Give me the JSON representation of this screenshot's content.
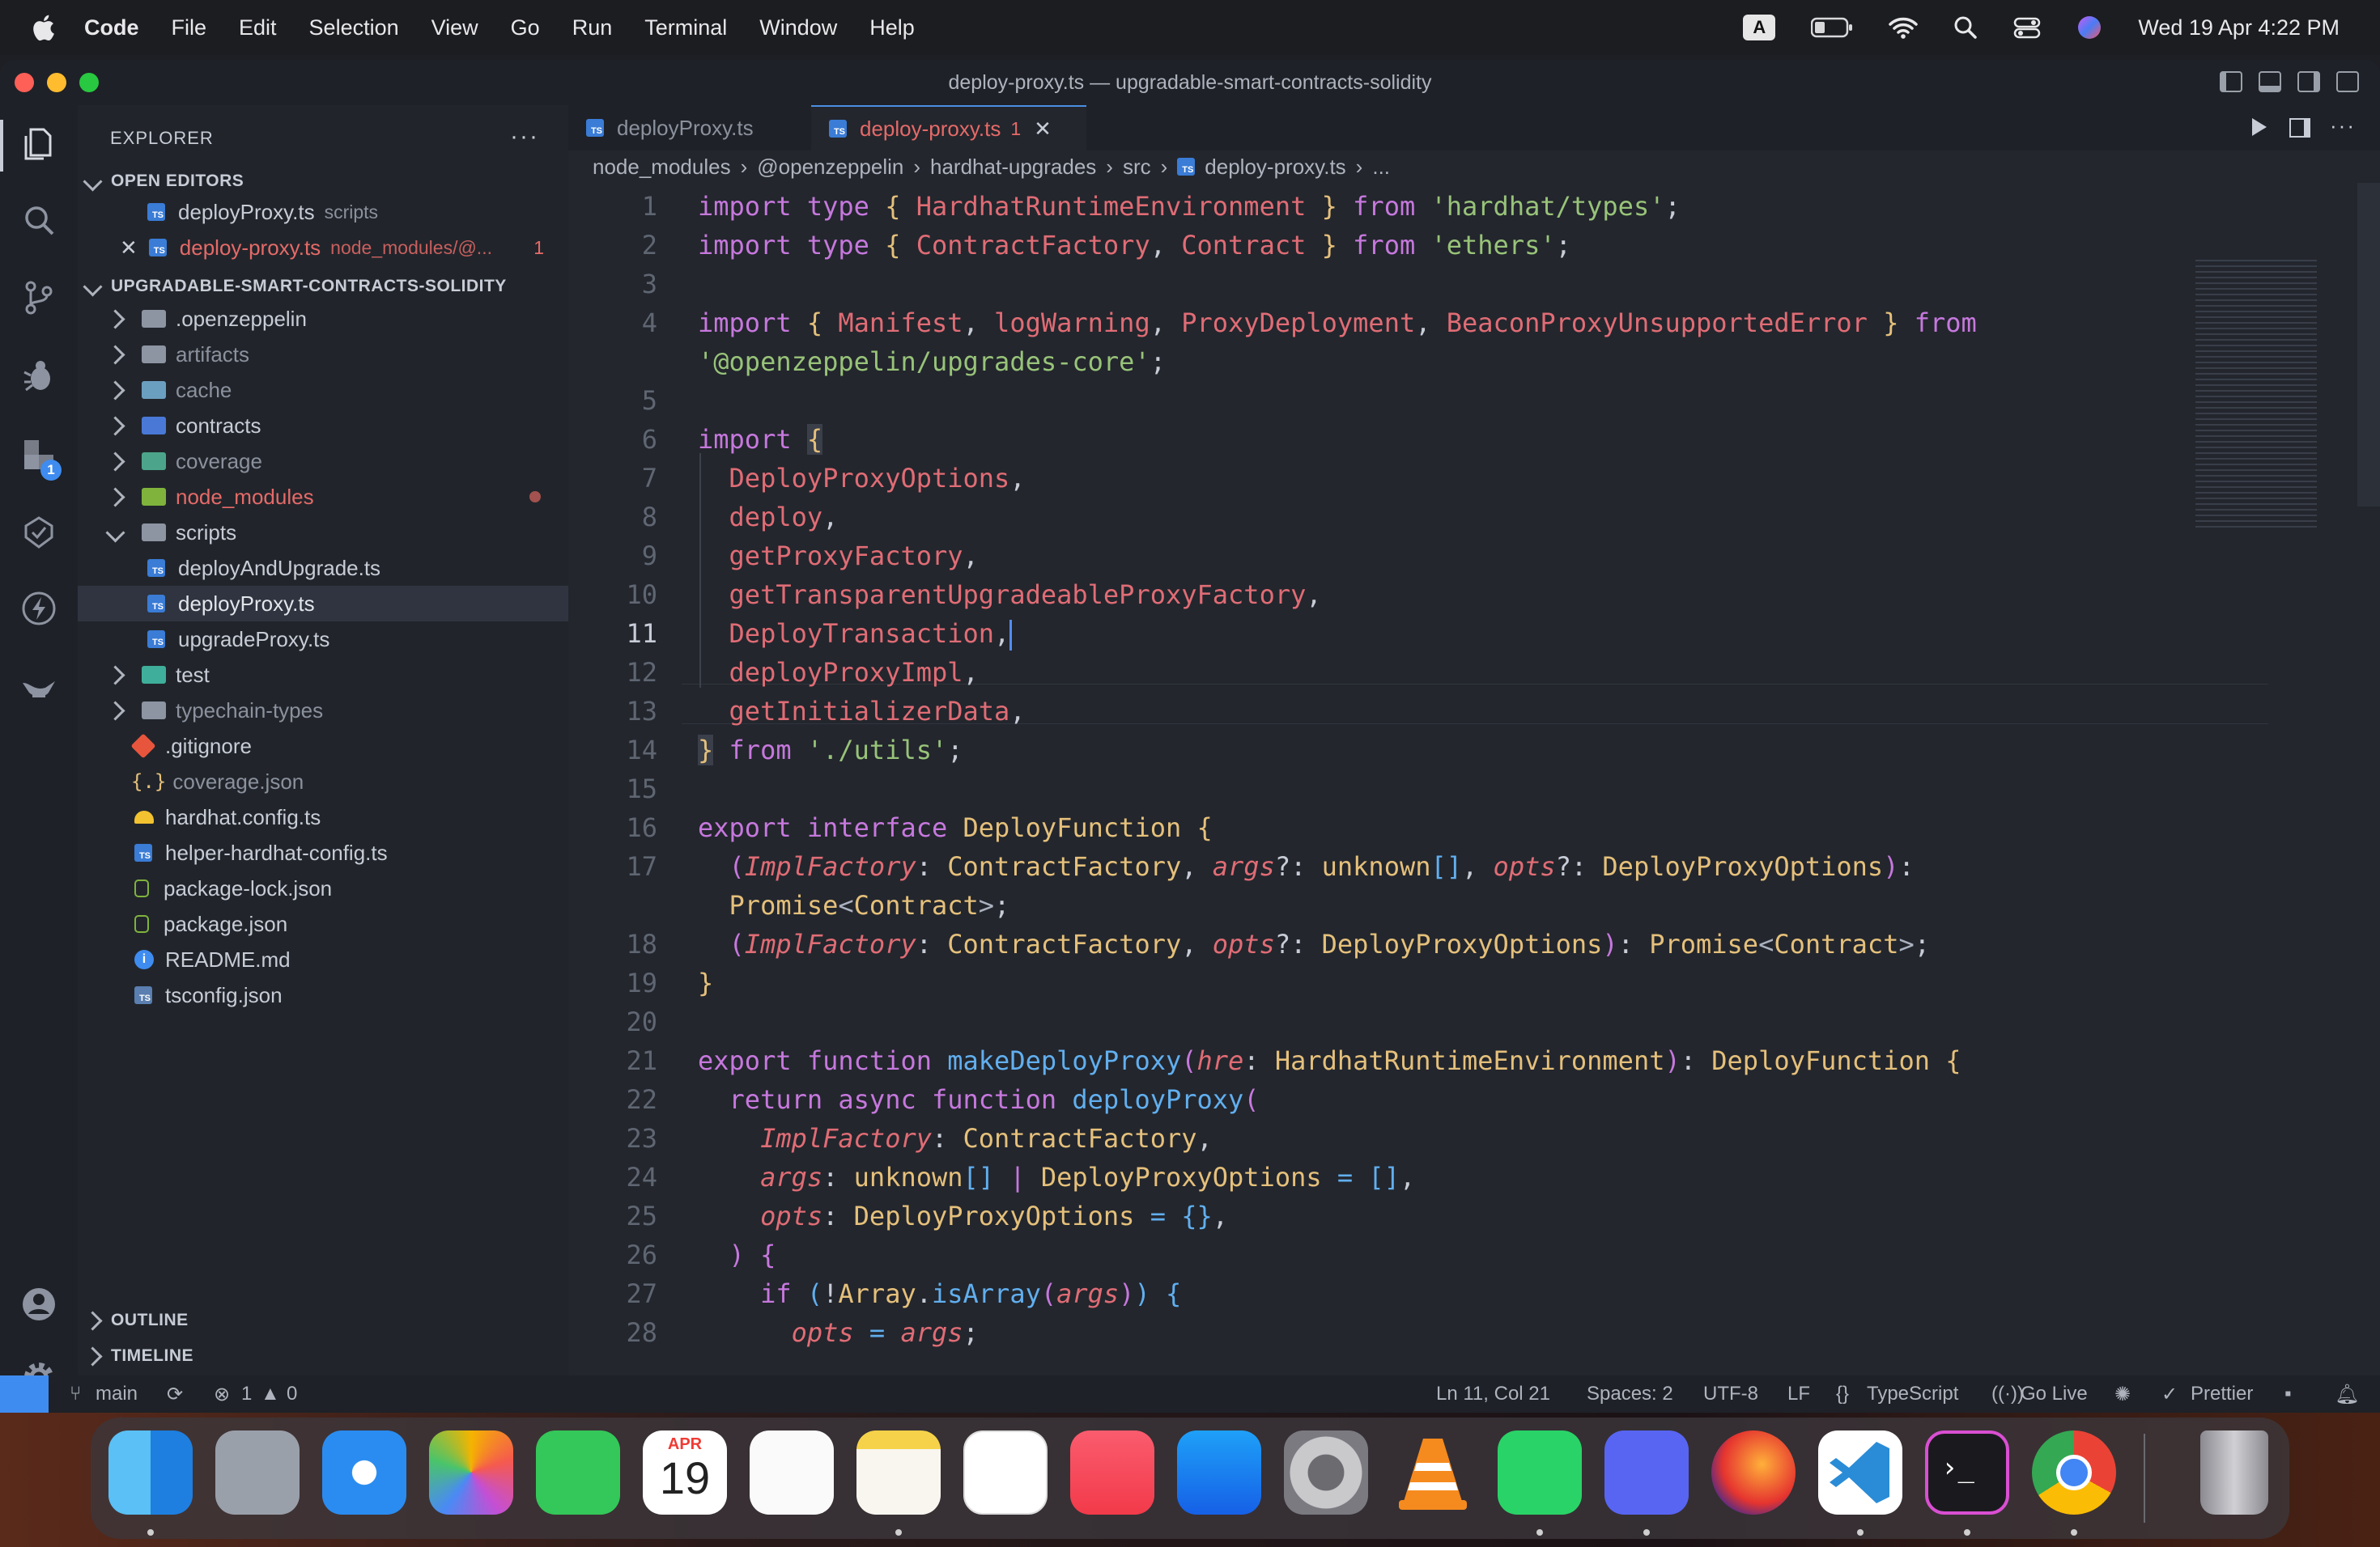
{
  "menubar": {
    "items": [
      "Code",
      "File",
      "Edit",
      "Selection",
      "View",
      "Go",
      "Run",
      "Terminal",
      "Window",
      "Help"
    ],
    "input_indicator": "A",
    "datetime": "Wed 19 Apr  4:22 PM"
  },
  "window": {
    "title": "deploy-proxy.ts — upgradable-smart-contracts-solidity"
  },
  "activity": {
    "extensions_badge": "1"
  },
  "sidebar": {
    "title": "EXPLORER",
    "more": "···",
    "open_editors_label": "OPEN EDITORS",
    "open_editors": [
      {
        "name": "deployProxy.ts",
        "desc": "scripts"
      },
      {
        "name": "deploy-proxy.ts",
        "desc": "node_modules/@...",
        "problems": "1"
      }
    ],
    "project_label": "UPGRADABLE-SMART-CONTRACTS-SOLIDITY",
    "tree": [
      ".openzeppelin",
      "artifacts",
      "cache",
      "contracts",
      "coverage",
      "node_modules",
      "scripts",
      "deployAndUpgrade.ts",
      "deployProxy.ts",
      "upgradeProxy.ts",
      "test",
      "typechain-types",
      ".gitignore",
      "coverage.json",
      "hardhat.config.ts",
      "helper-hardhat-config.ts",
      "package-lock.json",
      "package.json",
      "README.md",
      "tsconfig.json"
    ],
    "outline_label": "OUTLINE",
    "timeline_label": "TIMELINE"
  },
  "tabs": [
    {
      "label": "deployProxy.ts"
    },
    {
      "label": "deploy-proxy.ts",
      "problems": "1"
    }
  ],
  "breadcrumb": [
    "node_modules",
    "@openzeppelin",
    "hardhat-upgrades",
    "src",
    "deploy-proxy.ts",
    "..."
  ],
  "editor": {
    "line_numbers": [
      "1",
      "2",
      "3",
      "4",
      "",
      "5",
      "6",
      "7",
      "8",
      "9",
      "10",
      "11",
      "12",
      "13",
      "14",
      "15",
      "16",
      "17",
      "",
      "18",
      "19",
      "20",
      "21",
      "22",
      "23",
      "24",
      "25",
      "26",
      "27",
      "28"
    ]
  },
  "status": {
    "branch": "main",
    "errors": "1",
    "warnings": "0",
    "position": "Ln 11, Col 21",
    "spaces": "Spaces: 2",
    "encoding": "UTF-8",
    "eol": "LF",
    "language": "TypeScript",
    "golive": "Go Live",
    "prettier": "Prettier"
  },
  "dock": {
    "calendar_month": "APR",
    "calendar_day": "19"
  }
}
